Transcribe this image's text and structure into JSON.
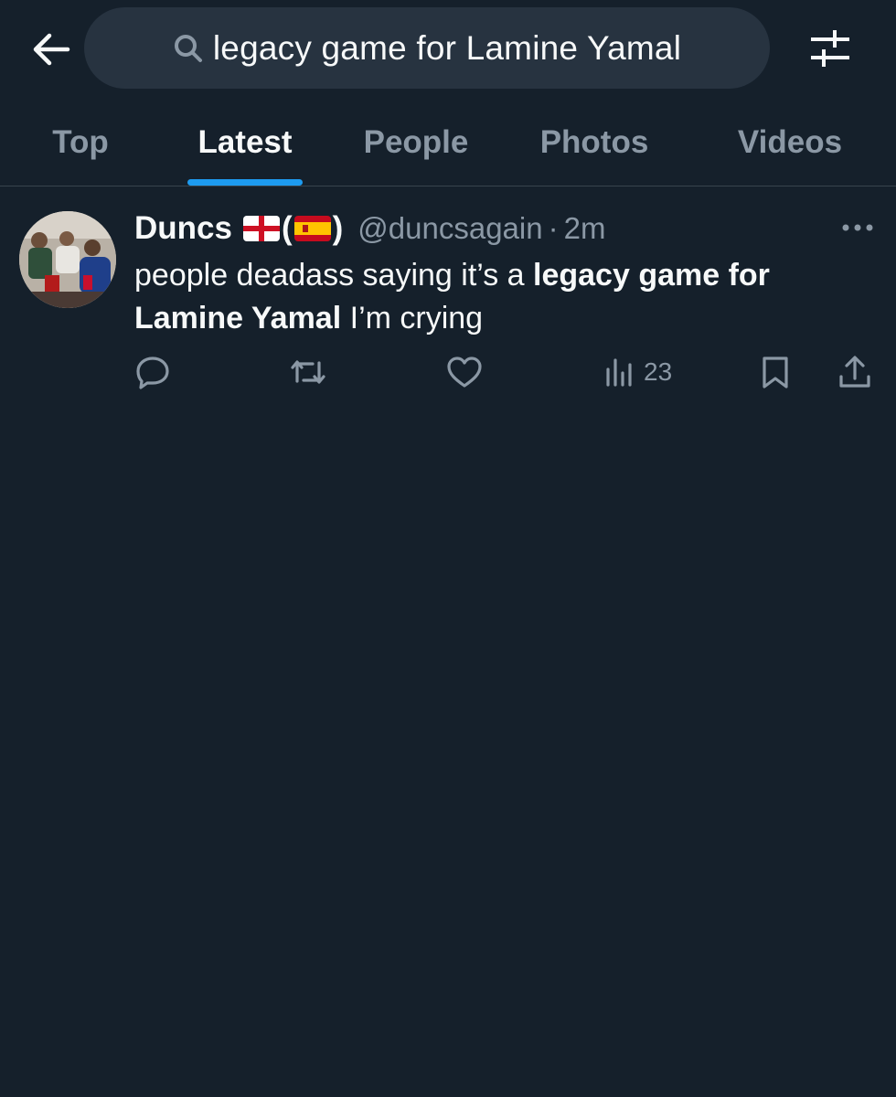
{
  "search": {
    "query": "legacy game for Lamine Yamal"
  },
  "tabs": [
    {
      "label": "Top",
      "active": false
    },
    {
      "label": "Latest",
      "active": true
    },
    {
      "label": "People",
      "active": false
    },
    {
      "label": "Photos",
      "active": false
    },
    {
      "label": "Videos",
      "active": false
    }
  ],
  "tweet": {
    "display_name": "Duncs",
    "name_suffix": [
      "🏴󠁧󠁢󠁥󠁮󠁧󠁿",
      "(",
      "🇪🇸",
      ")"
    ],
    "handle": "@duncsagain",
    "separator": "·",
    "time": "2m",
    "text_before": "people deadass saying it’s a ",
    "text_bold": "legacy game for Lamine Yamal",
    "text_after": " I’m crying",
    "views": "23"
  },
  "icons": {
    "back": "arrow-left-icon",
    "search": "search-icon",
    "filter": "filter-sliders-icon",
    "more": "more-horizontal-icon",
    "reply": "reply-icon",
    "retweet": "retweet-icon",
    "like": "heart-icon",
    "views": "analytics-icon",
    "bookmark": "bookmark-icon",
    "share": "share-icon"
  },
  "colors": {
    "background": "#15202b",
    "search_bg": "#273340",
    "accent": "#1d9bf0",
    "muted": "#8b98a5",
    "text": "#f7f9f9",
    "divider": "#38444d"
  }
}
